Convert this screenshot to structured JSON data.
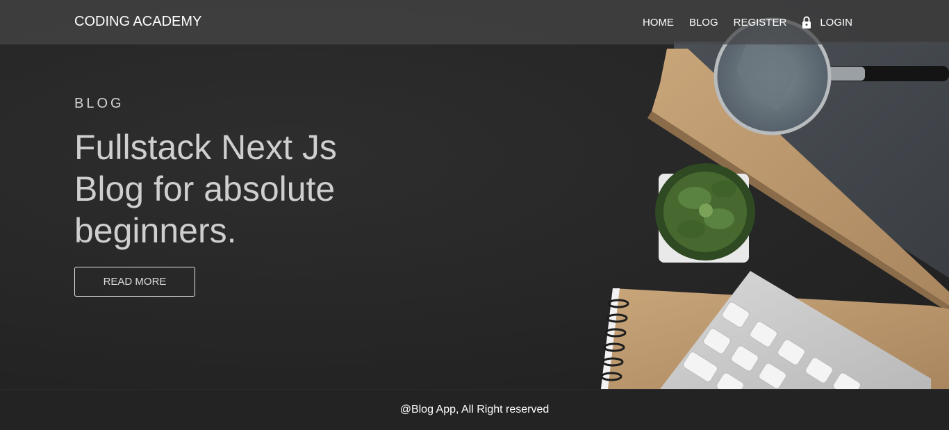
{
  "navbar": {
    "brand": "CODING ACADEMY",
    "links": [
      {
        "label": "HOME"
      },
      {
        "label": "BLOG"
      },
      {
        "label": "REGISTER"
      },
      {
        "label": "LOGIN",
        "icon": "lock-icon"
      }
    ]
  },
  "hero": {
    "kicker": "BLOG",
    "headline": "Fullstack Next Js Blog for absolute beginners.",
    "button_label": "READ MORE",
    "image_icons": [
      "magnifying-glass",
      "succulent-plant",
      "spiral-notebook",
      "keyboard"
    ]
  },
  "footer": {
    "text": "@Blog App, All Right reserved"
  },
  "colors": {
    "background": "#262626",
    "navbar": "#464648",
    "text": "#ffffff",
    "headline": "#cfcfcf"
  }
}
